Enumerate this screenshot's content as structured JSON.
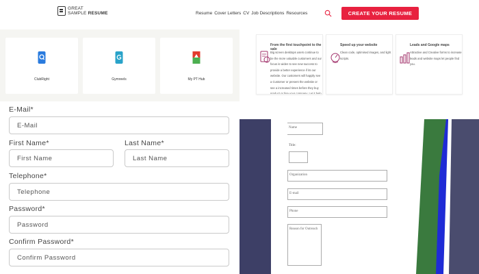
{
  "header": {
    "logo": {
      "line1": "GREAT",
      "line2a": "SAMPLE",
      "line2b": "RESUME"
    },
    "nav": [
      "Resume",
      "Cover Letters",
      "CV",
      "Job Descriptions",
      "Resources"
    ],
    "cta_label": "CREATE YOUR RESUME",
    "cta_color": "#e8213f"
  },
  "integrations": [
    {
      "label": "ClubRight",
      "icon": "clubright-icon",
      "color": "#2a7bde"
    },
    {
      "label": "Gymreels",
      "icon": "gymreels-icon",
      "color": "#29a3c9"
    },
    {
      "label": "My PT Hub",
      "icon": "myptHub-icon",
      "color": "#f07b22"
    }
  ],
  "features": [
    {
      "title": "From the first touchpoint to the sale",
      "text": "Big screen desktops users continue to be the more valuable customers and our focus is widen to see new success to provide a better experience if its our website. Our customers will happily see a Customer or present the website or see a increased times before they buy product or hire your company. Let it help them in the user journey."
    },
    {
      "title": "Speed up your website",
      "text": "Clean code, optimised images, and light scripts."
    },
    {
      "title": "Leads and Google maps",
      "text": "Attractive and Creative forms to increase leads and website maps let people find you."
    }
  ],
  "register_form": {
    "email": {
      "label": "E-Mail*",
      "placeholder": "E-Mail"
    },
    "first_name": {
      "label": "First Name*",
      "placeholder": "First Name"
    },
    "last_name": {
      "label": "Last Name*",
      "placeholder": "Last Name"
    },
    "telephone": {
      "label": "Telephone*",
      "placeholder": "Telephone"
    },
    "password": {
      "label": "Password*",
      "placeholder": "Password"
    },
    "confirm_password": {
      "label": "Confirm Password*",
      "placeholder": "Confirm Password"
    }
  },
  "contact_form": {
    "name": "Name",
    "title_label": "Title:",
    "organization": "Organization",
    "email": "E-mail",
    "phone": "Phone",
    "reason": "Reason for Outreach"
  },
  "decor_colors": {
    "navy": "#3d3f66",
    "green": "#3a7a3e",
    "blue": "#1f2bd6",
    "slate": "#4a4c6e"
  }
}
